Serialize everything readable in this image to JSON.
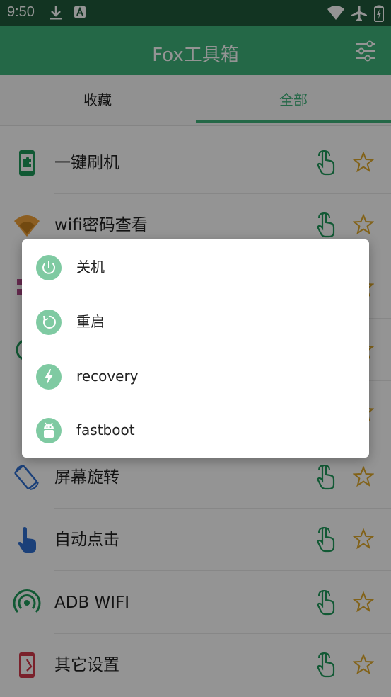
{
  "status_bar": {
    "time": "9:50",
    "icons": [
      "download-icon",
      "a-badge-icon",
      "wifi-icon",
      "airplane-icon",
      "battery-charging-icon"
    ]
  },
  "app_bar": {
    "title": "Fox工具箱",
    "settings_icon": "settings-sliders-icon"
  },
  "tabs": [
    {
      "label": "收藏"
    },
    {
      "label": "全部",
      "selected": true
    }
  ],
  "tool_list": [
    {
      "label": "一键刷机",
      "icon": "phone-puzzle-icon"
    },
    {
      "label": "wifi密码查看",
      "icon": "wifi-fan-icon"
    },
    {
      "label": "",
      "icon": "grid-icon"
    },
    {
      "label": "",
      "icon": "circle-icon"
    },
    {
      "label": "",
      "icon": ""
    },
    {
      "label": "屏幕旋转",
      "icon": "screen-rotate-icon"
    },
    {
      "label": "自动点击",
      "icon": "tap-hand-icon"
    },
    {
      "label": "ADB WIFI",
      "icon": "wireless-icon"
    },
    {
      "label": "其它设置",
      "icon": "phone-settings-icon"
    }
  ],
  "dialog": {
    "options": [
      {
        "label": "关机",
        "icon": "power-icon"
      },
      {
        "label": "重启",
        "icon": "restart-icon"
      },
      {
        "label": "recovery",
        "icon": "bolt-icon"
      },
      {
        "label": "fastboot",
        "icon": "android-icon"
      }
    ]
  },
  "colors": {
    "status_bar": "#1f5a3b",
    "app_bar": "#3fb37a",
    "accent": "#3fb37a",
    "star": "#e0a92a",
    "dialog_icon_bg": "#7fcaa2"
  }
}
